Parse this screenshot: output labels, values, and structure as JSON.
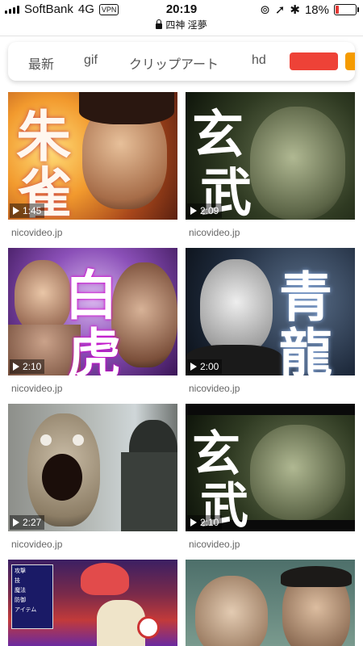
{
  "status_bar": {
    "carrier": "SoftBank",
    "network": "4G",
    "vpn": "VPN",
    "time": "20:19",
    "battery": "18%",
    "battery_level": 0.18
  },
  "url_bar": {
    "title": "四神 淫夢"
  },
  "chips": [
    "最新",
    "gif",
    "クリップアート",
    "hd"
  ],
  "colors": {
    "chip_red": "#ee4237",
    "chip_orange": "#f59b00"
  },
  "cards": [
    {
      "duration": "1:45",
      "source": "nicovideo.jp",
      "overlay": [
        "朱",
        "雀"
      ]
    },
    {
      "duration": "2:09",
      "source": "nicovideo.jp",
      "overlay": [
        "玄",
        "武"
      ]
    },
    {
      "duration": "2:10",
      "source": "nicovideo.jp",
      "overlay": [
        "白",
        "虎"
      ]
    },
    {
      "duration": "2:00",
      "source": "nicovideo.jp",
      "overlay": [
        "青",
        "龍"
      ]
    },
    {
      "duration": "2:27",
      "source": "nicovideo.jp"
    },
    {
      "duration": "2:10",
      "source": "nicovideo.jp",
      "overlay": [
        "玄",
        "武"
      ]
    },
    {
      "menu": [
        "攻撃",
        "技",
        "魔法",
        "防御",
        "アイテム"
      ]
    },
    {}
  ]
}
